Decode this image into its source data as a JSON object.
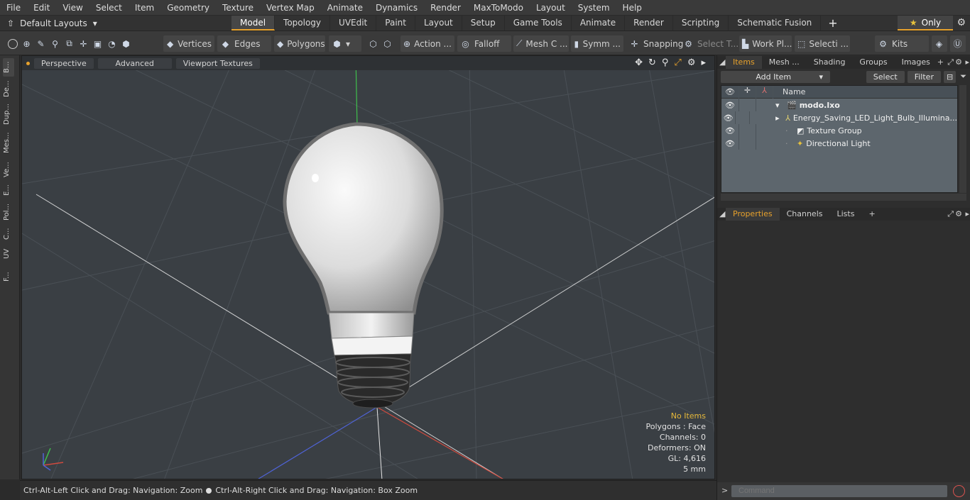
{
  "menu": [
    "File",
    "Edit",
    "View",
    "Select",
    "Item",
    "Geometry",
    "Texture",
    "Vertex Map",
    "Animate",
    "Dynamics",
    "Render",
    "MaxToModo",
    "Layout",
    "System",
    "Help"
  ],
  "layouts_label": "Default Layouts",
  "tabs": [
    "Model",
    "Topology",
    "UVEdit",
    "Paint",
    "Layout",
    "Setup",
    "Game Tools",
    "Animate",
    "Render",
    "Scripting",
    "Schematic Fusion"
  ],
  "active_tab": "Model",
  "only_label": "Only",
  "toolbar": {
    "vertices": "Vertices",
    "edges": "Edges",
    "polygons": "Polygons",
    "action": "Action ...",
    "falloff": "Falloff",
    "mesh": "Mesh C ...",
    "symm": "Symm ...",
    "snapping": "Snapping",
    "select_t": "Select T...",
    "work_pl": "Work Pl...",
    "selecti": "Selecti ...",
    "kits": "Kits"
  },
  "left_tabs": [
    "B...",
    "De...",
    "Dup...",
    "Mes...",
    "Ve...",
    "E...",
    "Pol...",
    "C...",
    "UV",
    "F..."
  ],
  "viewport": {
    "perspective": "Perspective",
    "advanced": "Advanced",
    "textures": "Viewport Textures",
    "hud": {
      "no_items": "No Items",
      "polygons": "Polygons : Face",
      "channels": "Channels: 0",
      "deformers": "Deformers: ON",
      "gl": "GL: 4,616",
      "units": "5 mm"
    }
  },
  "status": {
    "left": "Ctrl-Alt-Left Click and Drag: Navigation: Zoom",
    "right": "Ctrl-Alt-Right Click and Drag: Navigation: Box Zoom"
  },
  "panel_top_tabs": [
    "Items",
    "Mesh ...",
    "Shading",
    "Groups",
    "Images"
  ],
  "add_item": "Add Item",
  "select_btn": "Select",
  "filter_btn": "Filter",
  "items_header": "Name",
  "items": [
    {
      "name": "modo.lxo",
      "icon": "scene-icon"
    },
    {
      "name": "Energy_Saving_LED_Light_Bulb_Illumina...",
      "icon": "mesh-icon"
    },
    {
      "name": "Texture Group",
      "icon": "texture-group-icon"
    },
    {
      "name": "Directional Light",
      "icon": "light-icon"
    }
  ],
  "panel_bottom_tabs": [
    "Properties",
    "Channels",
    "Lists"
  ],
  "command_placeholder": "Command"
}
